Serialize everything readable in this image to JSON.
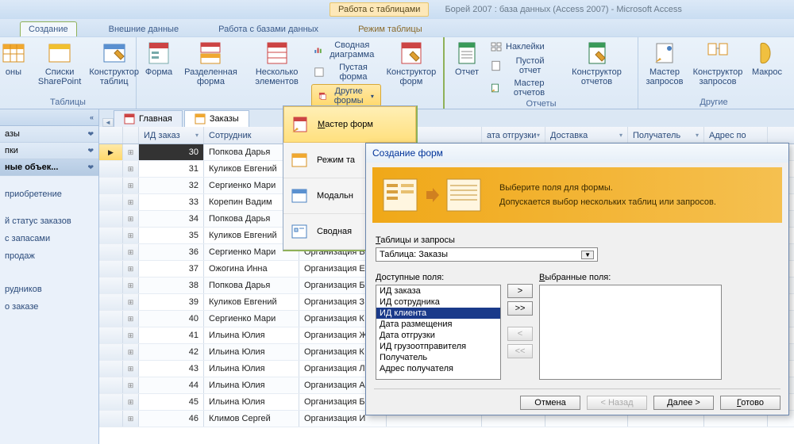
{
  "window": {
    "context_tab": "Работа с таблицами",
    "title": "Борей 2007 : база данных (Access 2007) - Microsoft Access"
  },
  "tabs": {
    "create": "Создание",
    "external": "Внешние данные",
    "dbwork": "Работа с базами данных",
    "tablemode": "Режим таблицы"
  },
  "ribbon": {
    "tables_group": "Таблицы",
    "designs": "оны",
    "sharepoint": "Списки SharePoint",
    "tabledesigner": "Конструктор таблиц",
    "form": "Форма",
    "splitform": "Разделенная форма",
    "multiitems": "Несколько элементов",
    "pivotchart": "Сводная диаграмма",
    "blankform": "Пустая форма",
    "otherforms": "Другие формы",
    "formdesigner": "Конструктор форм",
    "report": "Отчет",
    "labels": "Наклейки",
    "blankreport": "Пустой отчет",
    "reportwizard": "Мастер отчетов",
    "reportdesigner": "Конструктор отчетов",
    "reports_group": "Отчеты",
    "querywizard": "Мастер запросов",
    "querydesigner": "Конструктор запросов",
    "macro": "Макрос",
    "other_group": "Другие"
  },
  "dropdown": {
    "formwizard": "Мастер форм",
    "tablemode": "Режим та",
    "modal": "Модальн",
    "pivot": "Сводная"
  },
  "nav": {
    "header": "",
    "grp_orders": "азы",
    "grp_buttons": "пки",
    "grp_objects": "ные объек...",
    "item_purchase": "приобретение",
    "item_status": "й статус заказов",
    "item_stock": "с запасами",
    "item_sales": "продаж",
    "item_employees": "рудников",
    "item_about": "о заказе"
  },
  "doctabs": {
    "home": "Главная",
    "orders": "Заказы"
  },
  "grid": {
    "headers": {
      "id": "ИД заказ",
      "employee": "Сотрудник",
      "org": "",
      "placed": "",
      "shipped": "ата отгрузки",
      "delivery": "Доставка",
      "recipient": "Получатель",
      "addr": "Адрес по"
    },
    "rows": [
      {
        "id": "30",
        "emp": "Попкова Дарья",
        "org": ""
      },
      {
        "id": "31",
        "emp": "Куликов Евгений",
        "org": ""
      },
      {
        "id": "32",
        "emp": "Сергиенко Мари",
        "org": ""
      },
      {
        "id": "33",
        "emp": "Корепин Вадим",
        "org": ""
      },
      {
        "id": "34",
        "emp": "Попкова Дарья",
        "org": ""
      },
      {
        "id": "35",
        "emp": "Куликов Евгений",
        "org": "Организация И"
      },
      {
        "id": "36",
        "emp": "Сергиенко Мари",
        "org": "Организация В"
      },
      {
        "id": "37",
        "emp": "Ожогина Инна",
        "org": "Организация Е"
      },
      {
        "id": "38",
        "emp": "Попкова Дарья",
        "org": "Организация Б"
      },
      {
        "id": "39",
        "emp": "Куликов Евгений",
        "org": "Организация З"
      },
      {
        "id": "40",
        "emp": "Сергиенко Мари",
        "org": "Организация К"
      },
      {
        "id": "41",
        "emp": "Ильина Юлия",
        "org": "Организация Ж"
      },
      {
        "id": "42",
        "emp": "Ильина Юлия",
        "org": "Организация К"
      },
      {
        "id": "43",
        "emp": "Ильина Юлия",
        "org": "Организация Л"
      },
      {
        "id": "44",
        "emp": "Ильина Юлия",
        "org": "Организация А"
      },
      {
        "id": "45",
        "emp": "Ильина Юлия",
        "org": "Организация Б"
      },
      {
        "id": "46",
        "emp": "Климов Сергей",
        "org": "Организация И"
      }
    ]
  },
  "wizard": {
    "title": "Создание форм",
    "prompt": "Выберите поля для формы.",
    "hint": "Допускается выбор нескольких таблиц или запросов.",
    "tables_label": "Таблицы и запросы",
    "combo_value": "Таблица: Заказы",
    "available_label": "Доступные поля:",
    "selected_label": "Выбранные поля:",
    "fields": [
      "ИД заказа",
      "ИД сотрудника",
      "ИД клиента",
      "Дата размещения",
      "Дата отгрузки",
      "ИД грузоотправителя",
      "Получатель",
      "Адрес получателя"
    ],
    "btn_add": ">",
    "btn_addall": ">>",
    "btn_rem": "<",
    "btn_remall": "<<",
    "btn_cancel": "Отмена",
    "btn_back": "< Назад",
    "btn_next": "Далее >",
    "btn_finish": "Готово"
  }
}
